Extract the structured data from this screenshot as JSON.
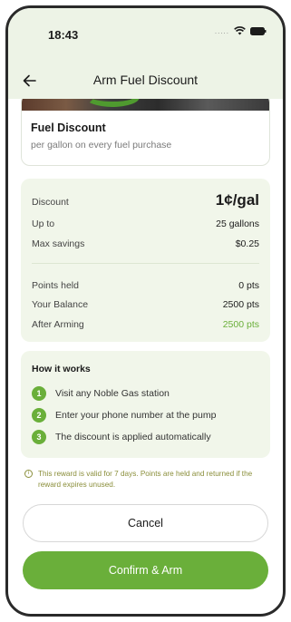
{
  "status_bar": {
    "time": "18:43"
  },
  "header": {
    "title": "Arm Fuel Discount"
  },
  "reward": {
    "name": "Fuel Discount",
    "description": "per gallon on every fuel purchase"
  },
  "summary": {
    "discount_label": "Discount",
    "discount_value": "1¢/gal",
    "up_to_label": "Up to",
    "up_to_value": "25 gallons",
    "max_savings_label": "Max savings",
    "max_savings_value": "$0.25",
    "points_held_label": "Points held",
    "points_held_value": "0 pts",
    "your_balance_label": "Your Balance",
    "your_balance_value": "2500 pts",
    "after_arming_label": "After Arming",
    "after_arming_value": "2500 pts"
  },
  "how_it_works": {
    "title": "How it works",
    "steps": [
      {
        "num": "1",
        "text": "Visit any Noble Gas station"
      },
      {
        "num": "2",
        "text": "Enter your phone number at the pump"
      },
      {
        "num": "3",
        "text": "The discount is applied automatically"
      }
    ]
  },
  "notice": {
    "text": "This reward is valid for 7 days. Points are held and returned if the reward expires unused."
  },
  "buttons": {
    "cancel_label": "Cancel",
    "confirm_label": "Confirm & Arm"
  },
  "colors": {
    "accent": "#6aaf3a",
    "panel": "#f1f6ea",
    "header_bg": "#edf3e6",
    "notice": "#8a8e3a"
  },
  "icons": {
    "back": "arrow-left-icon",
    "wifi": "wifi-icon",
    "battery": "battery-icon",
    "info": "info-icon"
  }
}
